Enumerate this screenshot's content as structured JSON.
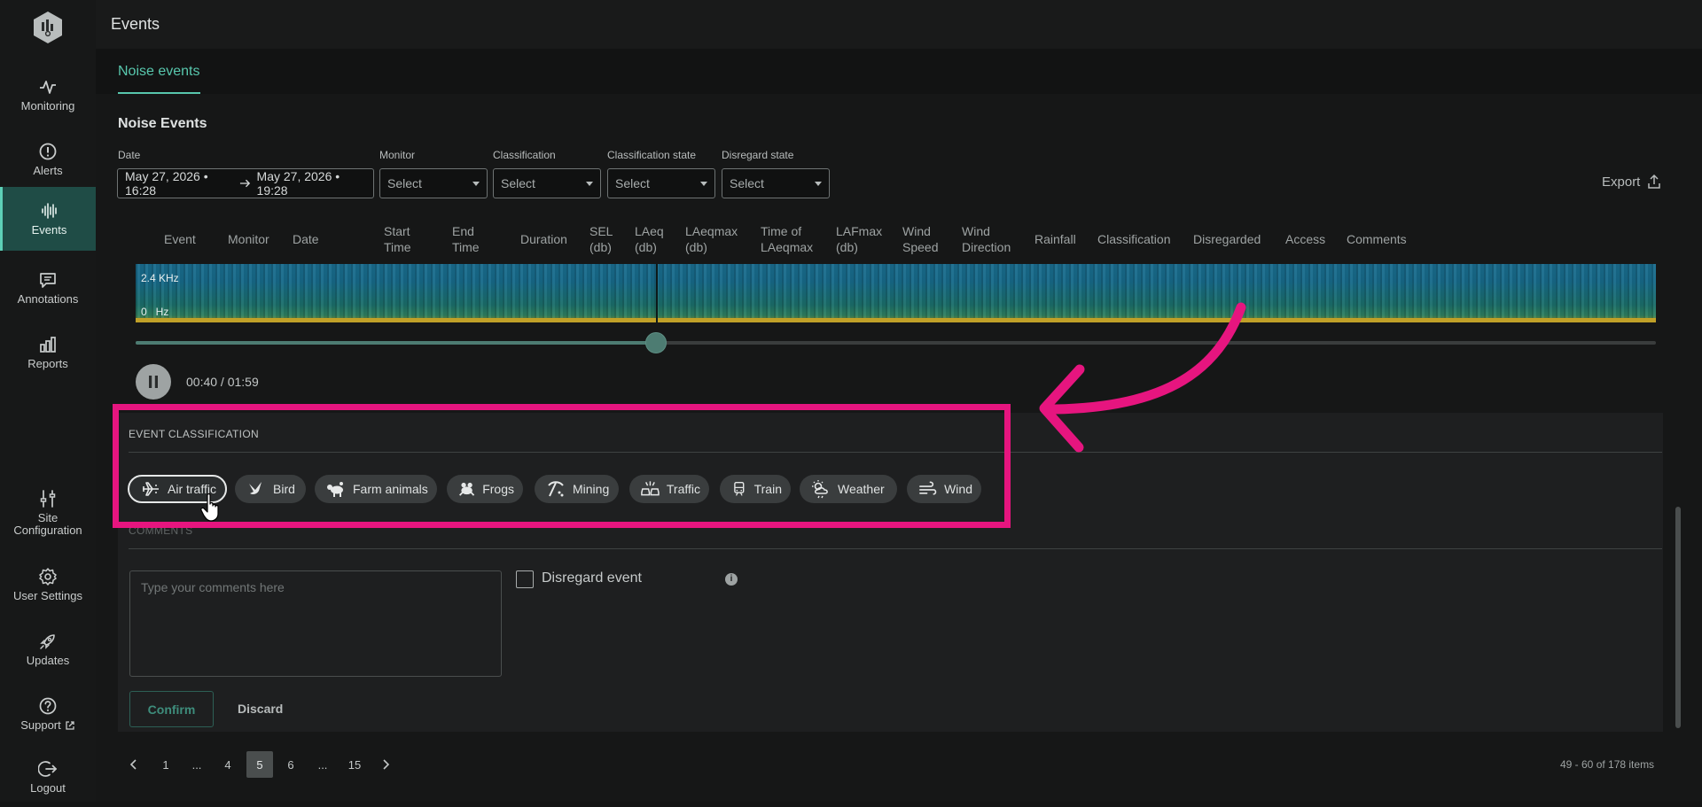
{
  "sidebar": {
    "items": [
      {
        "label": "Monitoring",
        "icon": "activity-icon"
      },
      {
        "label": "Alerts",
        "icon": "alert-icon"
      },
      {
        "label": "Events",
        "icon": "waveform-icon",
        "active": true
      },
      {
        "label": "Annotations",
        "icon": "comment-icon"
      },
      {
        "label": "Reports",
        "icon": "bar-chart-icon"
      },
      {
        "label": "Site Configuration",
        "icon": "sliders-icon"
      },
      {
        "label": "User Settings",
        "icon": "gear-icon"
      },
      {
        "label": "Updates",
        "icon": "rocket-icon"
      },
      {
        "label": "Support",
        "icon": "help-icon"
      },
      {
        "label": "Logout",
        "icon": "logout-icon"
      }
    ]
  },
  "header": {
    "title": "Events"
  },
  "tabs": {
    "noise_events": "Noise events"
  },
  "main": {
    "title": "Noise Events",
    "filters": {
      "date_label": "Date",
      "date_from": "May 27, 2026 • 16:28",
      "date_to": "May 27, 2026 • 19:28",
      "monitor_label": "Monitor",
      "classification_label": "Classification",
      "classification_state_label": "Classification state",
      "disregard_state_label": "Disregard state",
      "select_placeholder": "Select"
    },
    "export_label": "Export",
    "columns": [
      "Event",
      "Monitor",
      "Date",
      "Start Time",
      "End Time",
      "Duration",
      "SEL (db)",
      "LAeq (db)",
      "LAeqmax (db)",
      "Time of LAeqmax",
      "LAFmax (db)",
      "Wind Speed",
      "Wind Direction",
      "Rainfall",
      "Classification",
      "Disregarded",
      "Access",
      "Comments"
    ],
    "spectrogram": {
      "label_top": "2.4 KHz",
      "label_bottom": "0   Hz"
    },
    "player": {
      "time": "00:40 / 01:59",
      "progress": 0.343
    },
    "classification": {
      "heading": "EVENT CLASSIFICATION",
      "chips": [
        {
          "label": "Air traffic",
          "icon": "airplane-icon",
          "selected": true
        },
        {
          "label": "Bird",
          "icon": "bird-icon"
        },
        {
          "label": "Farm animals",
          "icon": "farm-animals-icon"
        },
        {
          "label": "Frogs",
          "icon": "frog-icon"
        },
        {
          "label": "Mining",
          "icon": "pickaxe-icon"
        },
        {
          "label": "Traffic",
          "icon": "cars-icon"
        },
        {
          "label": "Train",
          "icon": "train-icon"
        },
        {
          "label": "Weather",
          "icon": "weather-icon"
        },
        {
          "label": "Wind",
          "icon": "wind-icon"
        }
      ]
    },
    "comments": {
      "heading": "COMMENTS",
      "placeholder": "Type your comments here",
      "disregard_label": "Disregard event",
      "confirm": "Confirm",
      "discard": "Discard"
    },
    "pagination": {
      "pages": [
        "1",
        "...",
        "4",
        "5",
        "6",
        "...",
        "15"
      ],
      "current": "5",
      "items_text": "49 - 60 of 178 items"
    }
  },
  "colors": {
    "accent": "#58c7ad",
    "highlight": "#e6157f",
    "active_nav": "#1f4c46"
  }
}
